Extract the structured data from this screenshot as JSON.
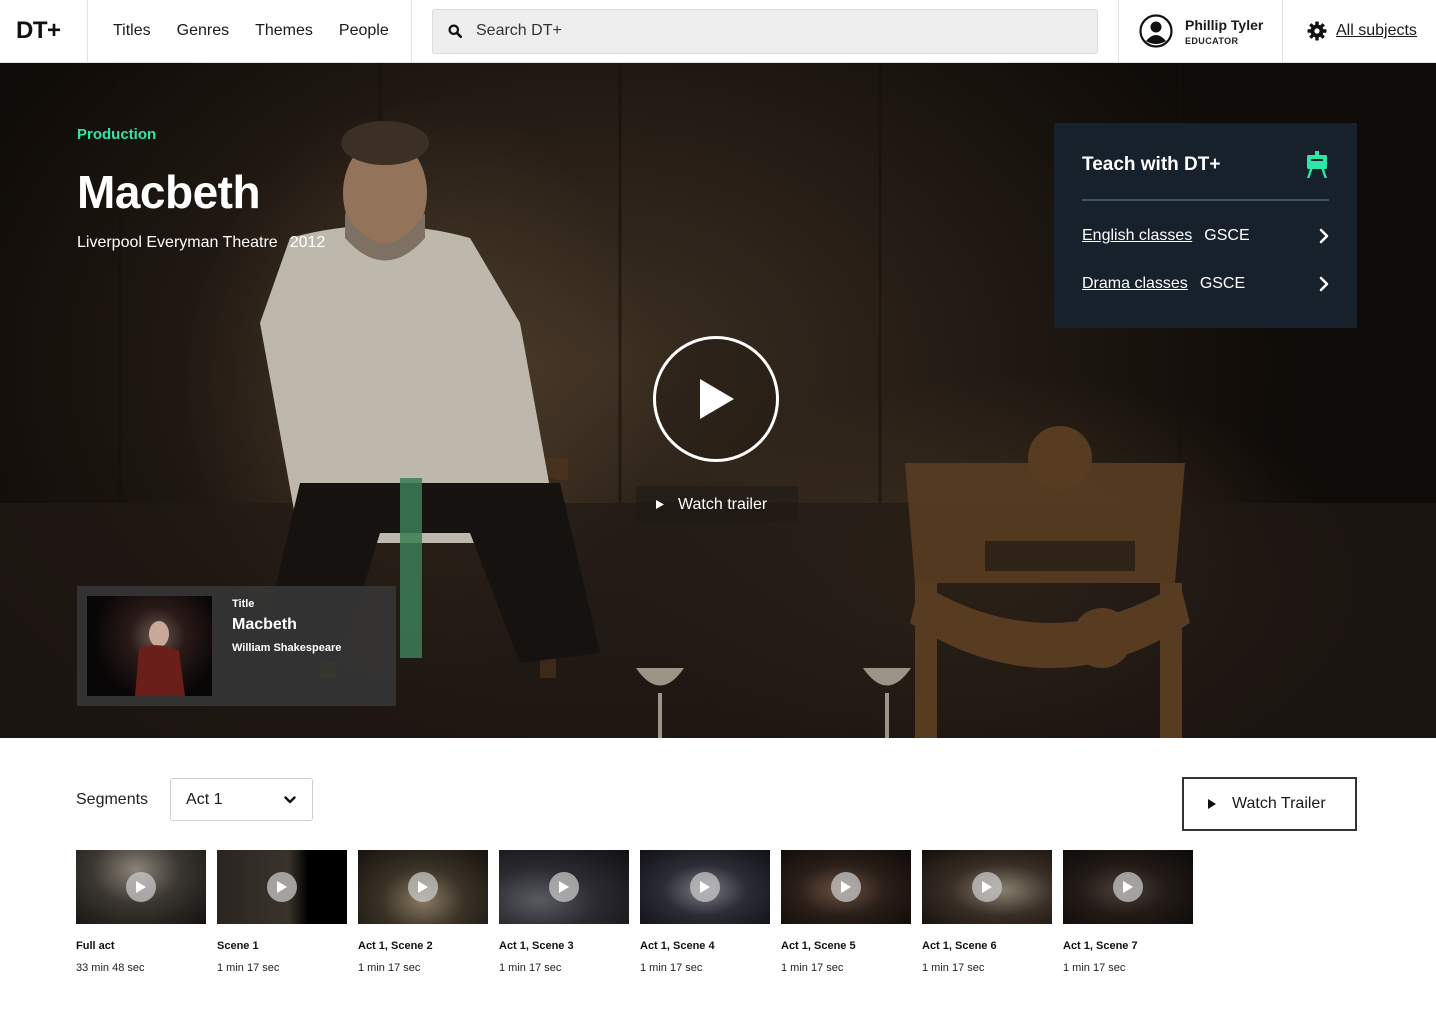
{
  "header": {
    "logo": "DT+",
    "nav": [
      "Titles",
      "Genres",
      "Themes",
      "People"
    ],
    "search_placeholder": "Search DT+",
    "user_name": "Phillip Tyler",
    "user_role": "EDUCATOR",
    "subjects_label": "All subjects"
  },
  "hero": {
    "kicker": "Production",
    "title": "Macbeth",
    "venue": "Liverpool Everyman Theatre",
    "year": "2012",
    "trailer_label": "Watch trailer"
  },
  "teach": {
    "title": "Teach with DT+",
    "rows": [
      {
        "link": "English classes",
        "level": "GSCE"
      },
      {
        "link": "Drama classes",
        "level": "GSCE"
      }
    ]
  },
  "title_card": {
    "label": "Title",
    "name": "Macbeth",
    "author": "William Shakespeare"
  },
  "segments": {
    "label": "Segments",
    "selected": "Act 1",
    "watch_trailer_label": "Watch Trailer",
    "items": [
      {
        "name": "Full act",
        "duration": "33 min 48 sec"
      },
      {
        "name": "Scene 1",
        "duration": "1 min 17 sec"
      },
      {
        "name": "Act 1, Scene 2",
        "duration": "1 min 17 sec"
      },
      {
        "name": "Act 1, Scene 3",
        "duration": "1 min 17 sec"
      },
      {
        "name": "Act 1, Scene 4",
        "duration": "1 min 17 sec"
      },
      {
        "name": "Act 1, Scene 5",
        "duration": "1 min 17 sec"
      },
      {
        "name": "Act 1, Scene 6",
        "duration": "1 min 17 sec"
      },
      {
        "name": "Act 1, Scene 7",
        "duration": "1 min 17 sec"
      }
    ]
  },
  "colors": {
    "accent": "#2ee6a8",
    "panel": "#17212b"
  }
}
